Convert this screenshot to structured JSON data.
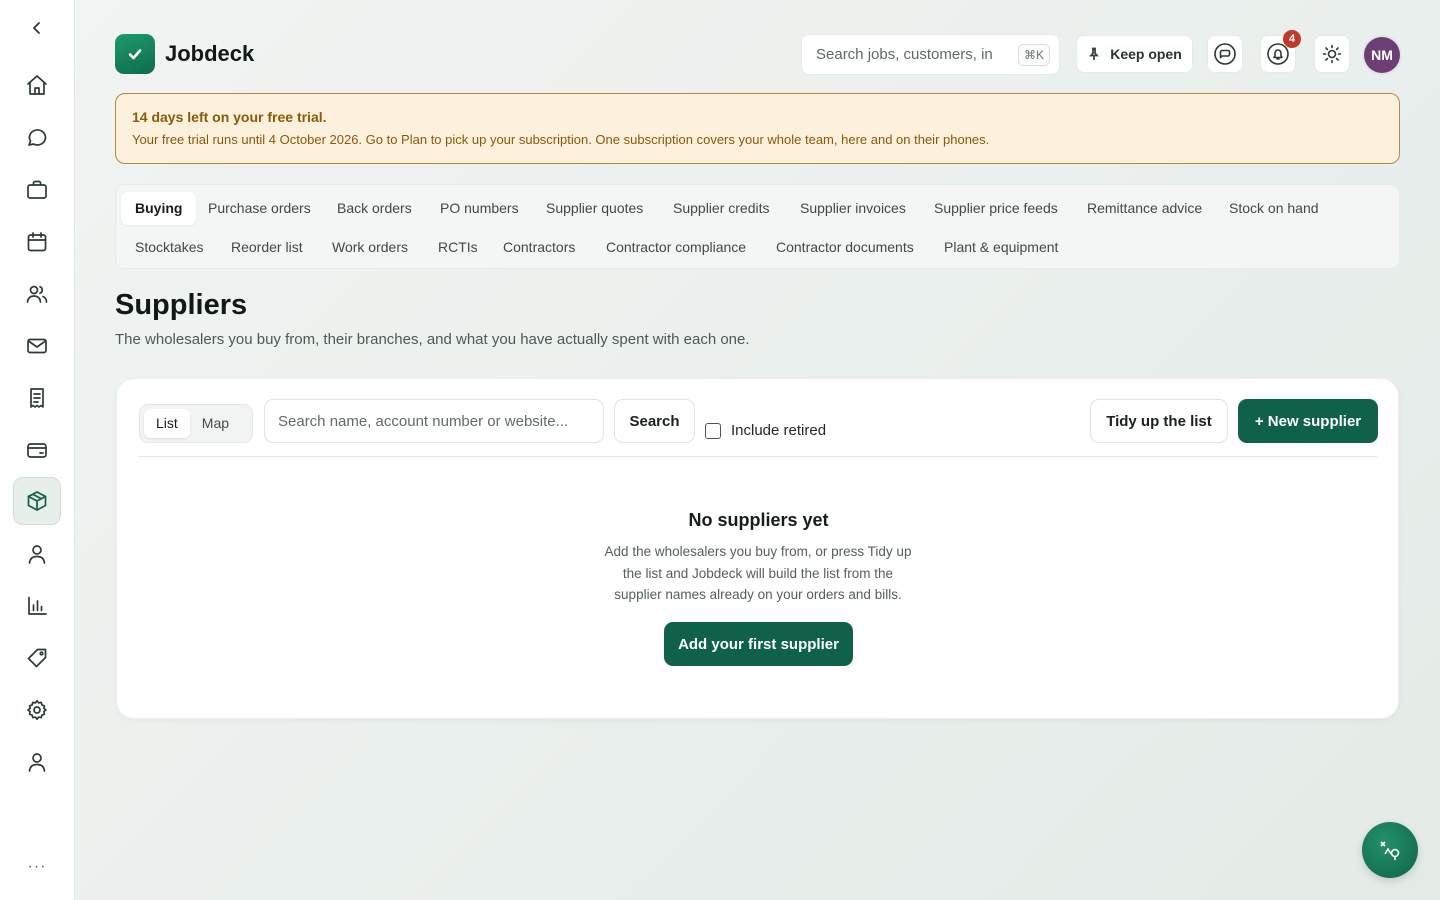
{
  "app": {
    "name": "Jobdeck"
  },
  "header": {
    "search_placeholder": "Search jobs, customers, invoices",
    "shortcut": "⌘K",
    "keep_open_label": "Keep open",
    "notifications_count": "4",
    "avatar_initials": "NM"
  },
  "sidebar": {
    "items": [
      {
        "icon": "home-icon"
      },
      {
        "icon": "chat-icon"
      },
      {
        "icon": "briefcase-icon"
      },
      {
        "icon": "calendar-icon"
      },
      {
        "icon": "users-icon"
      },
      {
        "icon": "mail-icon"
      },
      {
        "icon": "receipt-icon"
      },
      {
        "icon": "wallet-icon"
      },
      {
        "icon": "box-icon",
        "active": true
      },
      {
        "icon": "person-icon"
      },
      {
        "icon": "chart-icon"
      },
      {
        "icon": "tag-icon"
      },
      {
        "icon": "gear-icon"
      },
      {
        "icon": "account-icon"
      }
    ],
    "more_label": "···"
  },
  "trial": {
    "title": "14 days left on your free trial.",
    "text": "Your free trial runs until 4 October 2026. Go to Plan to pick up your subscription. One subscription covers your whole team, here and on their phones."
  },
  "tabs": [
    "Buying",
    "Purchase orders",
    "Back orders",
    "PO numbers",
    "Supplier quotes",
    "Supplier credits",
    "Supplier invoices",
    "Supplier price feeds",
    "Remittance advice",
    "Stock on hand",
    "Stocktakes",
    "Reorder list",
    "Work orders",
    "RCTIs",
    "Contractors",
    "Contractor compliance",
    "Contractor documents",
    "Plant & equipment"
  ],
  "active_tab": "Buying",
  "page": {
    "title": "Suppliers",
    "subtitle": "The wholesalers you buy from, their branches, and what you have actually spent with each one."
  },
  "toolbar": {
    "view_list": "List",
    "view_map": "Map",
    "search_placeholder": "Search name, account number or website...",
    "search_button": "Search",
    "include_retired": "Include retired",
    "tidy_button": "Tidy up the list",
    "new_button": "+ New supplier"
  },
  "empty": {
    "title": "No suppliers yet",
    "text": "Add the wholesalers you buy from, or press Tidy up the list and Jobdeck will build the list from the supplier names already on your orders and bills.",
    "button": "Add your first supplier"
  },
  "colors": {
    "brand": "#0f6149",
    "banner_bg": "#fdf0dd",
    "banner_text": "#8a5a06",
    "badge": "#c0392b",
    "avatar": "#6b3f74"
  }
}
